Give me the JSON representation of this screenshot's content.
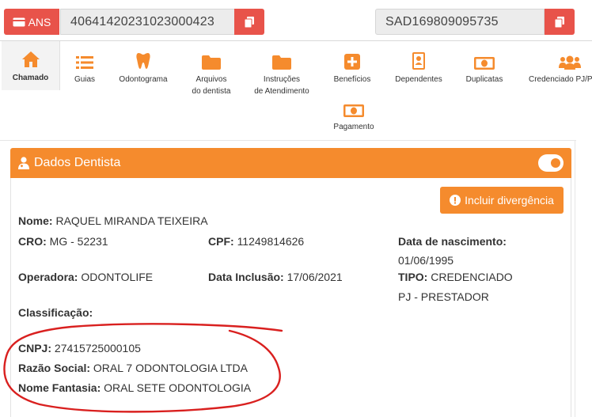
{
  "topbar": {
    "ans_label": "ANS",
    "ans_number": "40641420231023000423",
    "sad_number": "SAD169809095735",
    "accent_color": "#e8534a"
  },
  "nav": {
    "items": [
      {
        "label": "Chamado",
        "icon": "home-icon"
      },
      {
        "label": "Guias",
        "icon": "list-icon"
      },
      {
        "label": "Odontograma",
        "icon": "tooth-icon"
      },
      {
        "label_line1": "Arquivos",
        "label_line2": "do dentista",
        "icon": "folder-icon"
      },
      {
        "label_line1": "Instruções",
        "label_line2": "de Atendimento",
        "icon": "folder-icon"
      },
      {
        "label": "Benefícios",
        "icon": "plus-square-icon"
      },
      {
        "label": "Dependentes",
        "icon": "id-badge-icon"
      },
      {
        "label": "Duplicatas",
        "icon": "money-bill-icon"
      },
      {
        "label": "Credenciado PJ/Pre",
        "icon": "users-icon"
      },
      {
        "label": "Pagamento",
        "icon": "money-bill-icon"
      }
    ],
    "icon_color": "#f58b2d"
  },
  "panel": {
    "title": "Dados Dentista",
    "header_color": "#f58b2d",
    "divergence_button": "Incluir divergência"
  },
  "dentist": {
    "nome_label": "Nome:",
    "nome": "RAQUEL MIRANDA TEIXEIRA",
    "cro_label": "CRO:",
    "cro": "MG - 52231",
    "cpf_label": "CPF:",
    "cpf": "11249814626",
    "nasc_label": "Data de nascimento:",
    "nasc": "01/06/1995",
    "operadora_label": "Operadora:",
    "operadora": "ODONTOLIFE",
    "inclusao_label": "Data Inclusão:",
    "inclusao": "17/06/2021",
    "tipo_label": "TIPO:",
    "tipo_line1": "CREDENCIADO",
    "tipo_line2": "PJ - PRESTADOR",
    "classificacao_label": "Classificação:",
    "cnpj_label": "CNPJ:",
    "cnpj": "27415725000105",
    "razao_label": "Razão Social:",
    "razao": "ORAL 7 ODONTOLOGIA LTDA",
    "fantasia_label": "Nome Fantasia:",
    "fantasia": "ORAL SETE ODONTOLOGIA"
  },
  "annotation_color": "#d9201f"
}
